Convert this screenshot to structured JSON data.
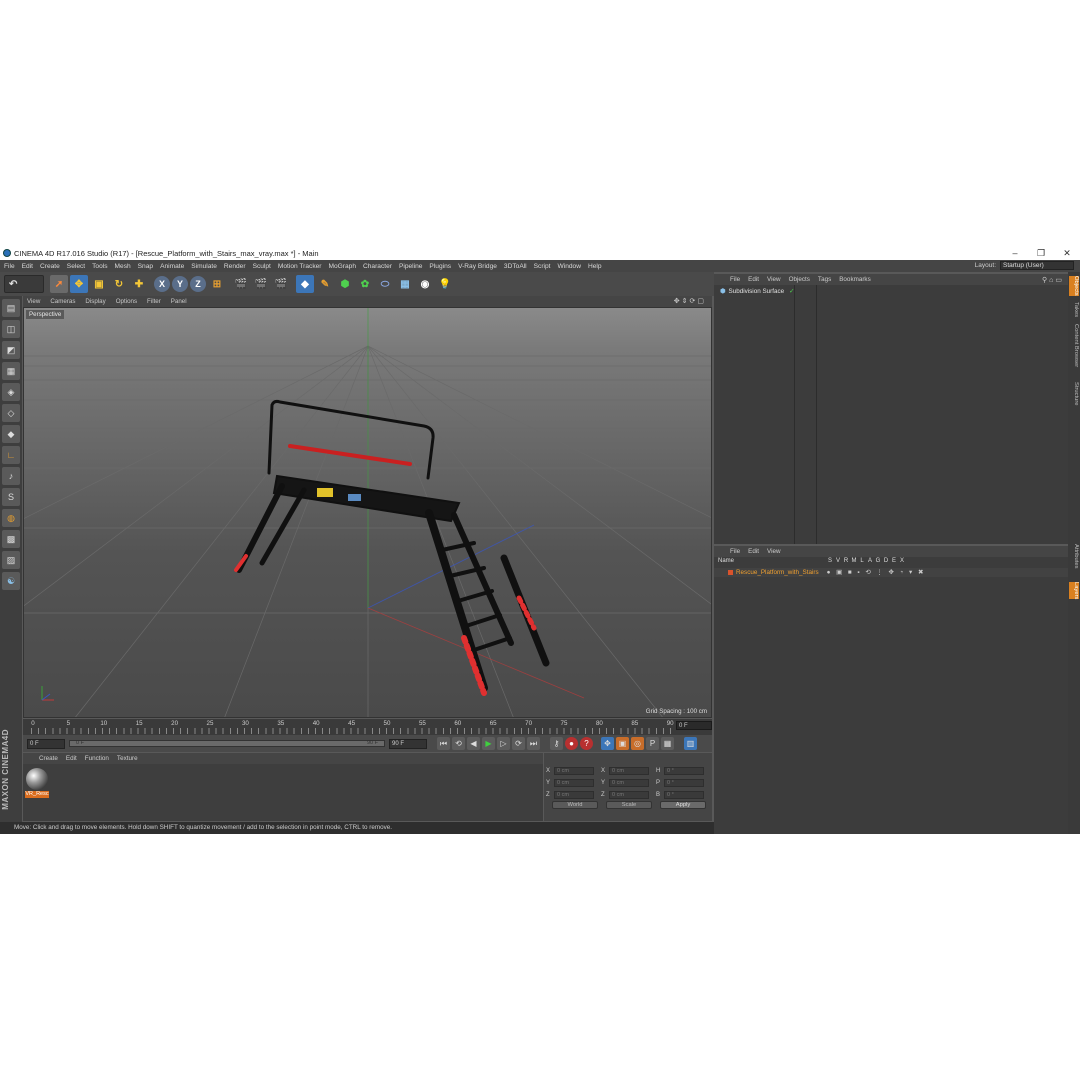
{
  "window": {
    "title": "CINEMA 4D R17.016 Studio (R17) - [Rescue_Platform_with_Stairs_max_vray.max *] - Main",
    "controls": [
      "–",
      "❐",
      "✕"
    ]
  },
  "menubar": [
    "File",
    "Edit",
    "Create",
    "Select",
    "Tools",
    "Mesh",
    "Snap",
    "Animate",
    "Simulate",
    "Render",
    "Sculpt",
    "Motion Tracker",
    "MoGraph",
    "Character",
    "Pipeline",
    "Plugins",
    "V-Ray Bridge",
    "3DToAll",
    "Script",
    "Window",
    "Help"
  ],
  "layout": {
    "label": "Layout:",
    "value": "Startup (User)"
  },
  "toolbar": {
    "undo_icon": "undo-icon",
    "tools": [
      "select-arrow-icon",
      "move-icon",
      "scale-icon",
      "rotate-icon",
      "add-object-icon"
    ],
    "axes": [
      "X",
      "Y",
      "Z"
    ],
    "render_tools": [
      "coordinate-system-icon",
      "render-view-icon",
      "render-picture-viewer-icon",
      "edit-render-settings-icon"
    ],
    "object_tools": [
      "cube-icon",
      "pen-icon",
      "subdivision-icon",
      "array-icon",
      "deformer-icon",
      "floor-icon",
      "camera-icon",
      "light-icon"
    ]
  },
  "viewport": {
    "menu": [
      "View",
      "Cameras",
      "Display",
      "Options",
      "Filter",
      "Panel"
    ],
    "camera_label": "Perspective",
    "grid_spacing": "Grid Spacing : 100 cm"
  },
  "timeline": {
    "ticks": [
      "0",
      "5",
      "10",
      "15",
      "20",
      "25",
      "30",
      "35",
      "40",
      "45",
      "50",
      "55",
      "60",
      "65",
      "70",
      "75",
      "80",
      "85",
      "90"
    ],
    "current_frame": "0 F",
    "start_field": "0 F",
    "range_start": "0 F",
    "range_end": "90 F",
    "end_field": "90 F"
  },
  "materials": {
    "menu": [
      "Create",
      "Edit",
      "Function",
      "Texture"
    ],
    "items": [
      {
        "label": "VR_Resc"
      }
    ]
  },
  "coords": {
    "rows": [
      {
        "a": "X",
        "av": "0 cm",
        "b": "X",
        "bv": "0 cm",
        "c": "H",
        "cv": "0 °"
      },
      {
        "a": "Y",
        "av": "0 cm",
        "b": "Y",
        "bv": "0 cm",
        "c": "P",
        "cv": "0 °"
      },
      {
        "a": "Z",
        "av": "0 cm",
        "b": "Z",
        "bv": "0 cm",
        "c": "B",
        "cv": "0 °"
      }
    ],
    "mode": "World",
    "scale_mode": "Scale",
    "apply": "Apply"
  },
  "status": "Move: Click and drag to move elements. Hold down SHIFT to quantize movement / add to the selection in point mode, CTRL to remove.",
  "object_manager": {
    "menu": [
      "File",
      "Edit",
      "View",
      "Objects",
      "Tags",
      "Bookmarks"
    ],
    "objects": [
      {
        "name": "Subdivision Surface"
      }
    ]
  },
  "layer_manager": {
    "menu": [
      "File",
      "Edit",
      "View"
    ],
    "columns": [
      "Name",
      "S",
      "V",
      "R",
      "M",
      "L",
      "A",
      "G",
      "D",
      "E",
      "X"
    ],
    "layers": [
      {
        "name": "Rescue_Platform_with_Stairs"
      }
    ]
  },
  "side_tabs": [
    "Objects",
    "Takes",
    "Content Browser",
    "Structure",
    "Attributes",
    "Layers"
  ],
  "colors": {
    "accent": "#d98020",
    "layer_name": "#f0a030",
    "enabled": "#4fd14f"
  }
}
